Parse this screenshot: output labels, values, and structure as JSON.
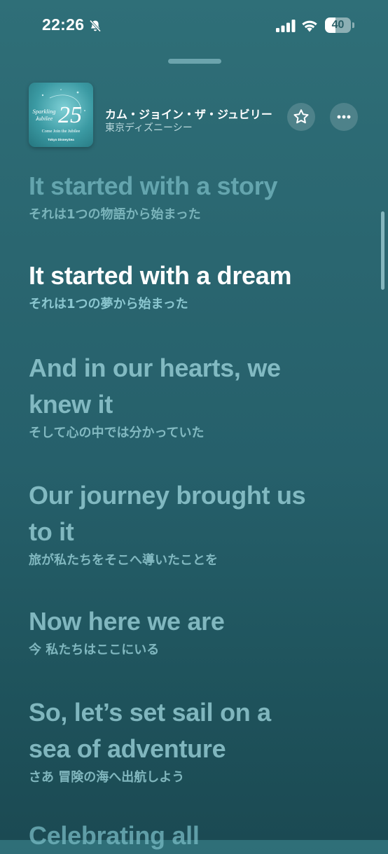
{
  "status_bar": {
    "time": "22:26",
    "battery_level": "40",
    "battery_fraction": 0.4
  },
  "now_playing": {
    "title": "カム・ジョイン・ザ・ジュビリー",
    "artist": "東京ディズニーシー",
    "artwork": {
      "text_sparkling": "Sparkling",
      "text_jubilee": "Jubilee",
      "text_number": "25",
      "text_tagline": "Come Join the Jubilee",
      "text_brand": "Tokyo DisneySea"
    }
  },
  "lyrics": [
    {
      "en": "It started with a story",
      "ja": "それは1つの物語から始まった",
      "state": "faded"
    },
    {
      "en": "It started with a dream",
      "ja": "それは1つの夢から始まった",
      "state": "active"
    },
    {
      "en_line1": "And in our hearts, we",
      "en_line2": "knew it",
      "ja": "そして心の中では分かっていた",
      "state": "upcoming"
    },
    {
      "en_line1": "Our journey brought us",
      "en_line2": "to it",
      "ja": "旅が私たちをそこへ導いたことを",
      "state": "upcoming"
    },
    {
      "en": "Now here we are",
      "ja": "今 私たちはここにいる",
      "state": "upcoming"
    },
    {
      "en_line1": "So, let’s set sail on a",
      "en_line2": "sea of adventure",
      "ja": "さあ 冒険の海へ出航しよう",
      "state": "upcoming"
    },
    {
      "en": "Celebrating all",
      "state": "upcoming"
    }
  ],
  "icons": {
    "mute": "bell-slash-icon",
    "signal": "cellular-signal-icon",
    "wifi": "wifi-icon",
    "favorite": "star-icon",
    "more": "ellipsis-icon"
  },
  "colors": {
    "background_top": "#2f6f78",
    "background_bottom": "#1b4a53",
    "lyric_inactive": "#96cdd4",
    "lyric_active": "#ffffff"
  }
}
